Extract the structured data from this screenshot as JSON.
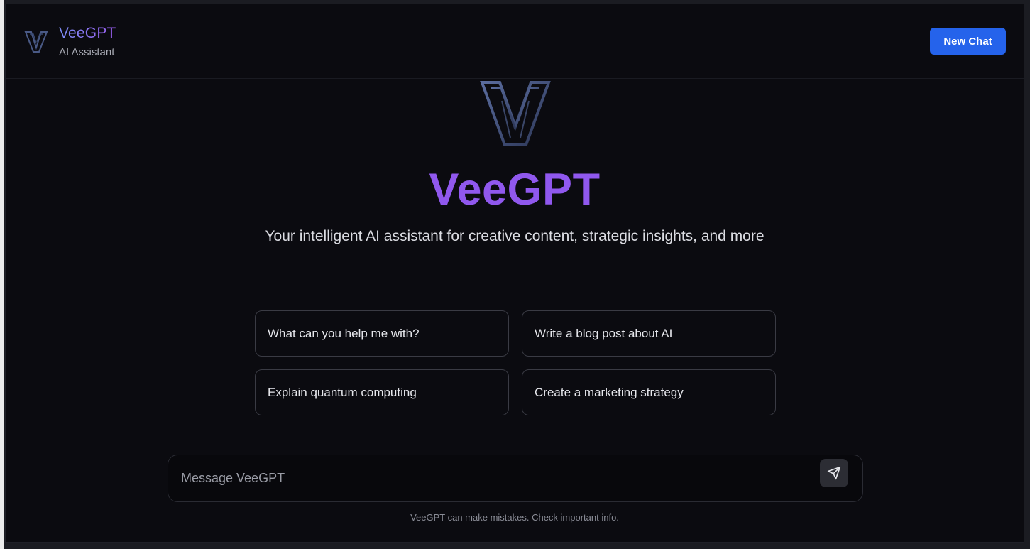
{
  "header": {
    "brand_title": "VeeGPT",
    "brand_subtitle": "AI Assistant",
    "new_chat_label": "New Chat"
  },
  "hero": {
    "title": "VeeGPT",
    "subtitle": "Your intelligent AI assistant for creative content, strategic insights, and more"
  },
  "suggestions": [
    {
      "label": "What can you help me with?"
    },
    {
      "label": "Write a blog post about AI"
    },
    {
      "label": "Explain quantum computing"
    },
    {
      "label": "Create a marketing strategy"
    }
  ],
  "composer": {
    "placeholder": "Message VeeGPT",
    "value": ""
  },
  "footer": {
    "disclaimer": "VeeGPT can make mistakes. Check important info."
  },
  "colors": {
    "accent": "#2563eb",
    "brand_purple": "#9058ee",
    "background": "#0b0b10"
  },
  "icons": {
    "logo": "veegpt-v-logo-icon",
    "send": "send-paper-plane-icon"
  }
}
